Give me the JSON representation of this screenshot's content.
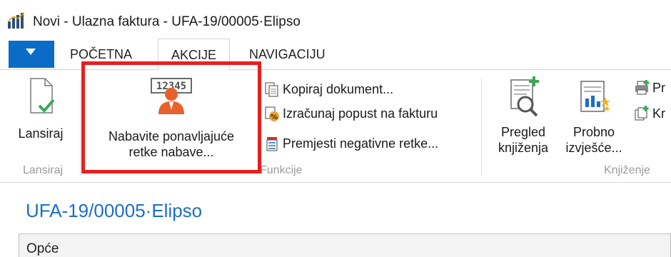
{
  "window": {
    "title": "Novi - Ulazna faktura - UFA-19/00005·Elipso",
    "app_icon": "bar-chart-icon"
  },
  "ribbon_tabs": {
    "menu_icon": "dropdown-arrow-icon",
    "tabs": [
      "POČETNA",
      "AKCIJE",
      "NAVIGACIJU"
    ],
    "active_tab": "AKCIJE"
  },
  "ribbon": {
    "groups": {
      "lansiraj": {
        "label": "Lansiraj",
        "buttons": [
          {
            "label": "Lansiraj",
            "icon": "document-check-icon"
          }
        ]
      },
      "funkcije": {
        "label": "Funkcije",
        "big_button": {
          "line1": "Nabavite ponavljajuće",
          "line2": "retke nabave...",
          "icon": "recurring-lines-person-icon"
        },
        "small_buttons": [
          {
            "label": "Kopiraj dokument...",
            "icon": "copy-document-icon"
          },
          {
            "label": "Izračunaj popust na fakturu",
            "icon": "percent-discount-icon"
          },
          {
            "label": "Premjesti negativne retke...",
            "icon": "move-lines-icon"
          }
        ]
      },
      "knjizenje": {
        "label": "Knjiženje",
        "buttons": [
          {
            "line1": "Pregled",
            "line2": "knjiženja",
            "icon": "preview-posting-icon"
          },
          {
            "line1": "Probno",
            "line2": "izvješće...",
            "icon": "test-report-icon"
          }
        ],
        "small_buttons": [
          {
            "label": "Pr",
            "icon": "printer-icon"
          },
          {
            "label": "Kr",
            "icon": "post-batch-icon"
          }
        ]
      }
    }
  },
  "highlight_color": "#e6201e",
  "accent_color": "#0a6cc6",
  "page": {
    "title": "UFA-19/00005·Elipso",
    "fasttab": "Opće"
  }
}
